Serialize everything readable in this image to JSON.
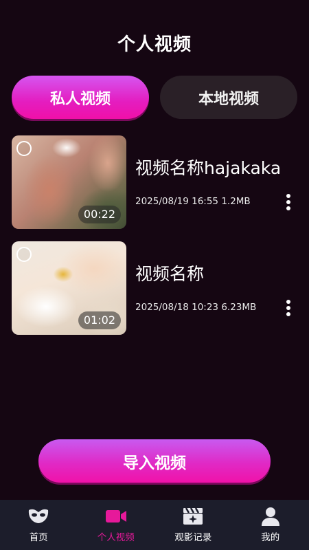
{
  "header": {
    "title": "个人视频"
  },
  "tabs": [
    {
      "label": "私人视频",
      "active": true
    },
    {
      "label": "本地视频",
      "active": false
    }
  ],
  "videos": [
    {
      "title": "视频名称hajakaka",
      "date": "2025/08/19",
      "time": "16:55",
      "size": "1.2MB",
      "duration": "00:22"
    },
    {
      "title": "视频名称",
      "date": "2025/08/18",
      "time": "10:23",
      "size": "6.23MB",
      "duration": "01:02"
    }
  ],
  "import_button": {
    "label": "导入视频"
  },
  "bottom_nav": [
    {
      "label": "首页",
      "icon": "mask-icon",
      "active": false
    },
    {
      "label": "个人视频",
      "icon": "video-camera-icon",
      "active": true
    },
    {
      "label": "观影记录",
      "icon": "clapperboard-icon",
      "active": false
    },
    {
      "label": "我的",
      "icon": "user-icon",
      "active": false
    }
  ],
  "colors": {
    "background": "#150612",
    "accent": "#e6199a",
    "nav_background": "#1c1d2b",
    "inactive_tab": "#2a2027"
  }
}
